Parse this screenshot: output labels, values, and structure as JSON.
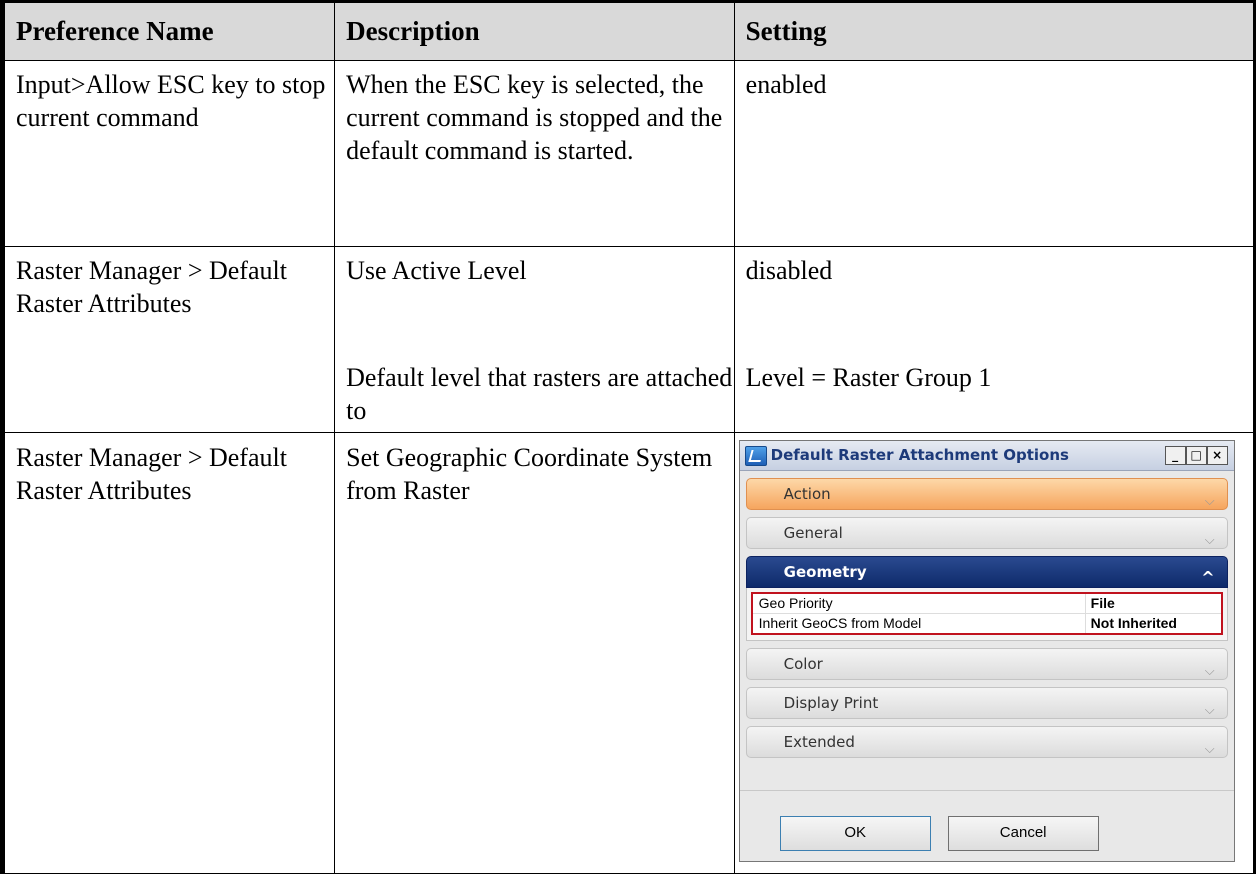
{
  "headers": [
    "Preference Name",
    "Description",
    "Setting"
  ],
  "rows": [
    {
      "name": "Input>Allow ESC key to stop current command",
      "description": "When the ESC key is selected, the current command is stopped and the default command is started.",
      "setting": "enabled"
    },
    {
      "name": "Raster Manager > Default Raster Attributes",
      "description": "Use Active Level",
      "setting": "disabled",
      "description2": "Default level that rasters are attached to",
      "setting2": "Level = Raster Group 1"
    },
    {
      "name": "Raster Manager > Default Raster Attributes",
      "description": "Set Geographic Coordinate System from Raster"
    }
  ],
  "dialog": {
    "title": "Default Raster Attachment Options",
    "window_buttons": [
      "_",
      "□",
      "×"
    ],
    "sections": {
      "action": "Action",
      "general": "General",
      "geometry": "Geometry",
      "color": "Color",
      "display_print": "Display Print",
      "extended": "Extended"
    },
    "properties": [
      {
        "name": "Geo Priority",
        "value": "File"
      },
      {
        "name": "Inherit GeoCS from Model",
        "value": "Not Inherited"
      }
    ],
    "buttons": {
      "ok": "OK",
      "cancel": "Cancel"
    },
    "colors": {
      "active_section": "#f6a55e",
      "expanded_section": "#0e2a6a",
      "highlight": "#c0121e"
    }
  }
}
